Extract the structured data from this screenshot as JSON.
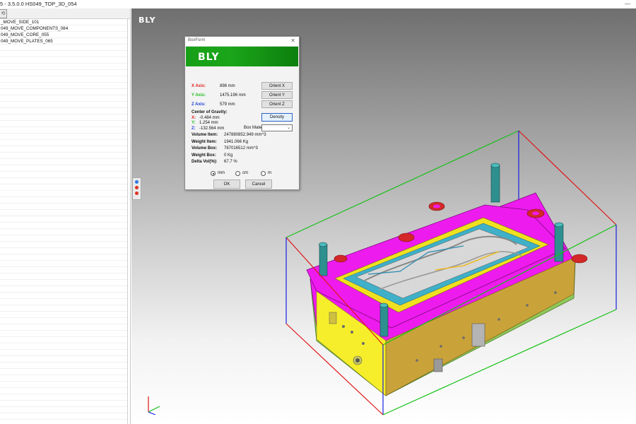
{
  "window": {
    "title": "5 - 3.5.0.0   HS049_TOP_3D_054",
    "close_glyph": "—"
  },
  "left_panel": {
    "toolbar_icon": "refresh-icon",
    "tree_items": [
      "_MOVE_SIDE_101",
      "049_MOVE_COMPONENTS_084",
      "049_MOVE_CORE_055",
      "049_MOVE_PLATES_065"
    ]
  },
  "viewport": {
    "logo": "BLY",
    "colors": {
      "box_x": "#e01515",
      "box_y": "#15c015",
      "box_z": "#1520e0",
      "part_magenta": "#ee1bee",
      "part_green": "#8fc85a"
    }
  },
  "dialog": {
    "title": "BoxForm",
    "close_glyph": "✕",
    "banner_logo": "BLY",
    "x_axis": {
      "label": "X Axis:",
      "value": "898 mm",
      "button": "Orient X"
    },
    "y_axis": {
      "label": "Y Axis:",
      "value": "1475.196 mm",
      "button": "Orient Y"
    },
    "z_axis": {
      "label": "Z Axis:",
      "value": "579 mm",
      "button": "Orient Z"
    },
    "cog": {
      "label": "Center of Gravity:",
      "x_label": "X:",
      "x_value": "-0.484 mm",
      "y_label": "Y:",
      "y_value": "1.254 mm",
      "z_label": "Z:",
      "z_value": "-132.564 mm"
    },
    "density_button": "Density",
    "box_material_label": "Box Material",
    "box_material_value": "",
    "stats": [
      {
        "label": "Volume Item:",
        "value": "247880852.949 mm^3"
      },
      {
        "label": "Weight Item:",
        "value": "1941.066 Kg"
      },
      {
        "label": "Volume Box:",
        "value": "767016512 mm^3"
      },
      {
        "label": "Weight Box:",
        "value": "0 Kg"
      },
      {
        "label": "Delta Vol(%):",
        "value": "67.7 %"
      }
    ],
    "units": [
      {
        "label": "mm",
        "checked": true
      },
      {
        "label": "cm",
        "checked": false
      },
      {
        "label": "m",
        "checked": false
      }
    ],
    "ok_button": "OK",
    "cancel_button": "Cancel"
  }
}
